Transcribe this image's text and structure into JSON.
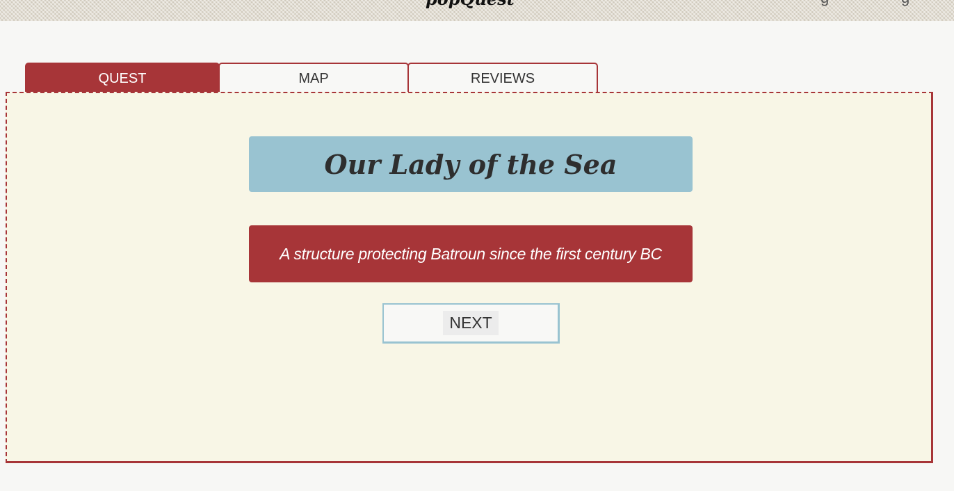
{
  "header": {
    "logo_text": "popQuest",
    "nav_fragments": [
      "g",
      "g"
    ]
  },
  "tabs": [
    {
      "label": "QUEST",
      "active": true
    },
    {
      "label": "MAP",
      "active": false
    },
    {
      "label": "REVIEWS",
      "active": false
    }
  ],
  "quest": {
    "title": "Our Lady of the Sea",
    "subtitle": "A structure protecting Batroun since the first century BC",
    "next_label": "NEXT"
  },
  "colors": {
    "accent_red": "#a73538",
    "title_blue": "#99c3d1",
    "panel_bg": "#f8f6e6",
    "page_bg": "#f7f7f5"
  }
}
